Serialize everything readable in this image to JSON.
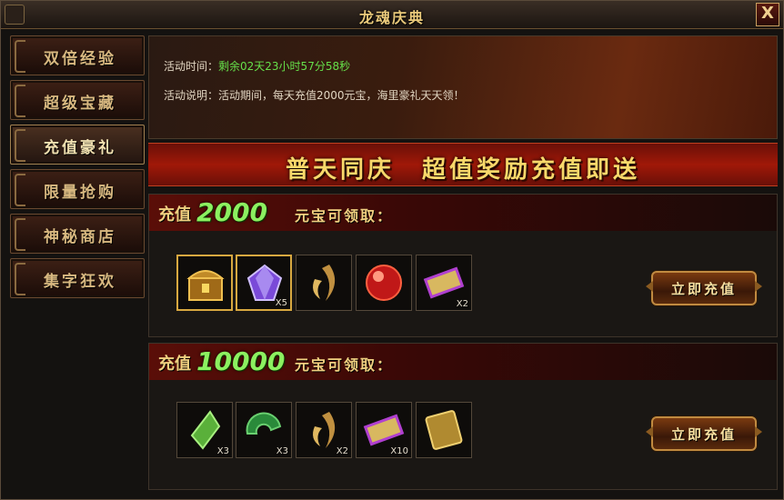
{
  "window": {
    "title": "龙魂庆典",
    "close_label": "X"
  },
  "sidebar": {
    "items": [
      {
        "label": "双倍经验"
      },
      {
        "label": "超级宝藏"
      },
      {
        "label": "充值豪礼"
      },
      {
        "label": "限量抢购"
      },
      {
        "label": "神秘商店"
      },
      {
        "label": "集字狂欢"
      }
    ],
    "active_index": 2
  },
  "info": {
    "time_label": "活动时间：",
    "time_value": "剩余02天23小时57分58秒",
    "desc_label": "活动说明：",
    "desc_value": "活动期间，每天充值2000元宝，海里豪礼天天领！"
  },
  "banner": {
    "text": "普天同庆　超值奖励充值即送"
  },
  "tiers": [
    {
      "prefix": "充值",
      "amount": "2000",
      "suffix": "元宝可领取：",
      "button_label": "立即充值",
      "items": [
        {
          "icon": "treasure-chest-icon",
          "qty": ""
        },
        {
          "icon": "purple-gem-icon",
          "qty": "X5"
        },
        {
          "icon": "golden-feather-icon",
          "qty": ""
        },
        {
          "icon": "red-orb-icon",
          "qty": ""
        },
        {
          "icon": "scroll-icon",
          "qty": "X2"
        }
      ]
    },
    {
      "prefix": "充值",
      "amount": "10000",
      "suffix": "元宝可领取：",
      "button_label": "立即充值",
      "items": [
        {
          "icon": "green-crystal-icon",
          "qty": "X3"
        },
        {
          "icon": "jade-disc-icon",
          "qty": "X3"
        },
        {
          "icon": "golden-feather-icon",
          "qty": "X2"
        },
        {
          "icon": "scroll-icon",
          "qty": "X10"
        },
        {
          "icon": "gold-tablet-icon",
          "qty": ""
        }
      ]
    }
  ],
  "colors": {
    "accent_gold": "#f0d080",
    "amount_green": "#8cf060",
    "timer_green": "#66e04a",
    "banner_red": "#a01808"
  }
}
